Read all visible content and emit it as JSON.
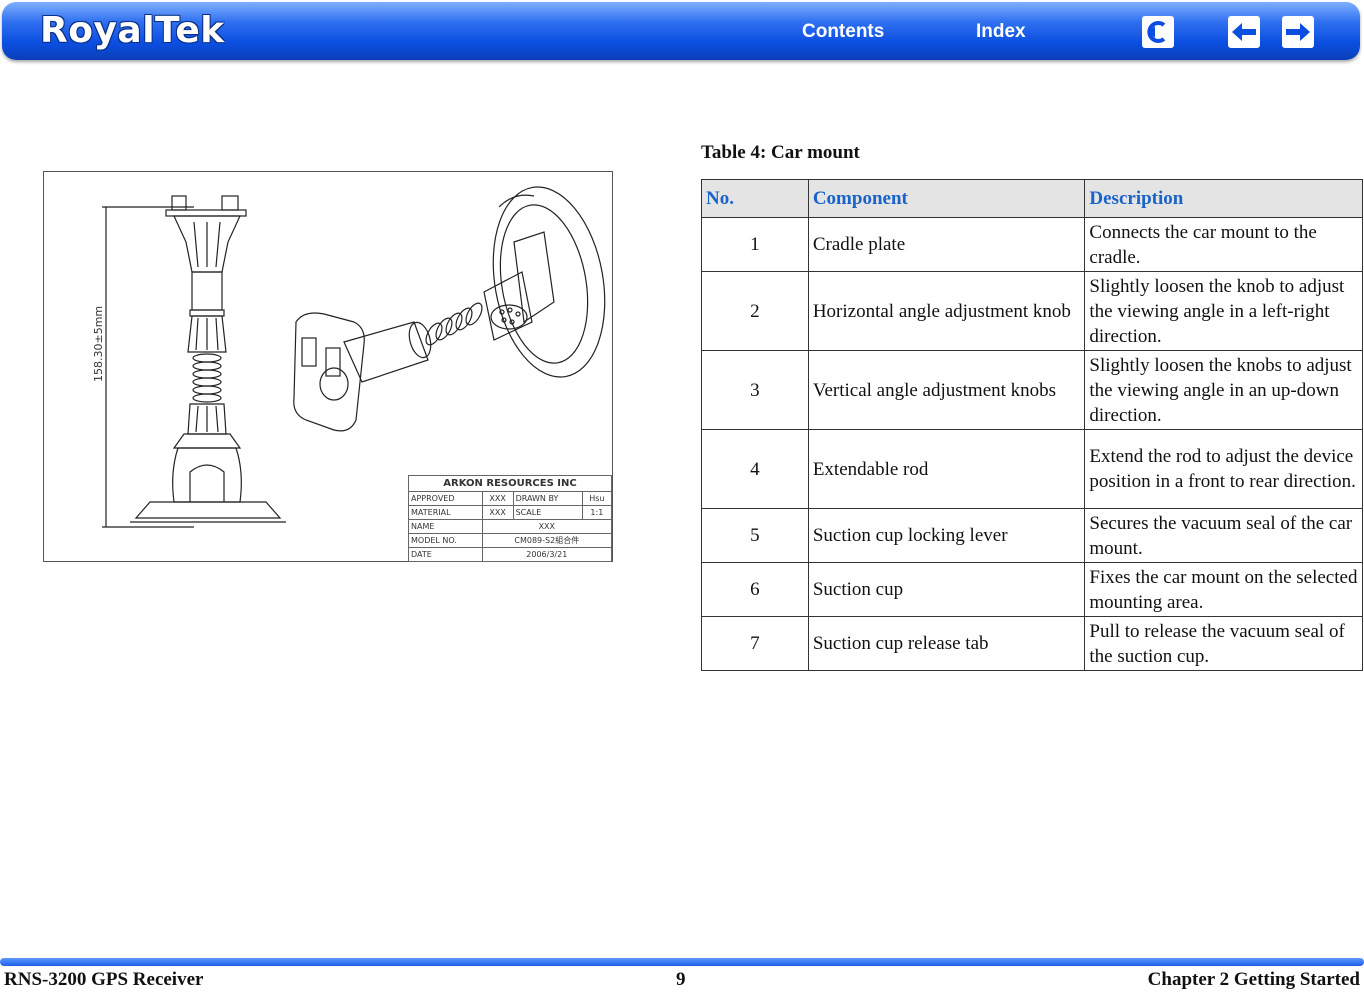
{
  "header": {
    "brand": "RoyalTek",
    "contents_label": "Contents",
    "index_label": "Index",
    "icons": [
      "back-icon",
      "previous-page-icon",
      "next-page-icon"
    ]
  },
  "drawing": {
    "dimension_label": "158.30±5mm",
    "title_block": {
      "company": "ARKON RESOURCES INC",
      "approved_label": "APPROVED",
      "approved_value": "XXX",
      "drawn_by_label": "DRAWN BY",
      "drawn_by_value": "Hsu",
      "material_label": "MATERIAL",
      "material_value": "XXX",
      "scale_label": "SCALE",
      "scale_value": "1:1",
      "name_label": "NAME",
      "name_value": "XXX",
      "model_label": "MODEL NO.",
      "model_value": "CM089-S2組合件",
      "date_label": "DATE",
      "date_value": "2006/3/21"
    }
  },
  "table": {
    "caption": "Table 4: Car mount",
    "headers": [
      "No.",
      "Component",
      "Description"
    ],
    "rows": [
      {
        "no": "1",
        "component": "Cradle plate",
        "description": "Connects the car mount to the cradle."
      },
      {
        "no": "2",
        "component": "Horizontal angle adjustment knob",
        "description": "Slightly loosen the knob to adjust the viewing angle in a left-right direction."
      },
      {
        "no": "3",
        "component": "Vertical angle adjustment knobs",
        "description": "Slightly loosen the knobs to adjust the viewing angle in an up-down direction."
      },
      {
        "no": "4",
        "component": "Extendable rod",
        "description": "Extend the rod to adjust the device position in a front to rear direction."
      },
      {
        "no": "5",
        "component": "Suction cup locking lever",
        "description": "Secures the vacuum seal of the car mount."
      },
      {
        "no": "6",
        "component": "Suction cup",
        "description": "Fixes the car mount on the selected mounting area."
      },
      {
        "no": "7",
        "component": "Suction cup release tab",
        "description": "Pull to release the vacuum seal of the suction cup."
      }
    ]
  },
  "footer": {
    "left": "RNS-3200 GPS Receiver",
    "page": "9",
    "right": "Chapter 2 Getting Started"
  },
  "colors": {
    "header_blue": "#0b4fe0",
    "table_header_text": "#1a63c9",
    "table_header_bg": "#e4e4e4"
  }
}
